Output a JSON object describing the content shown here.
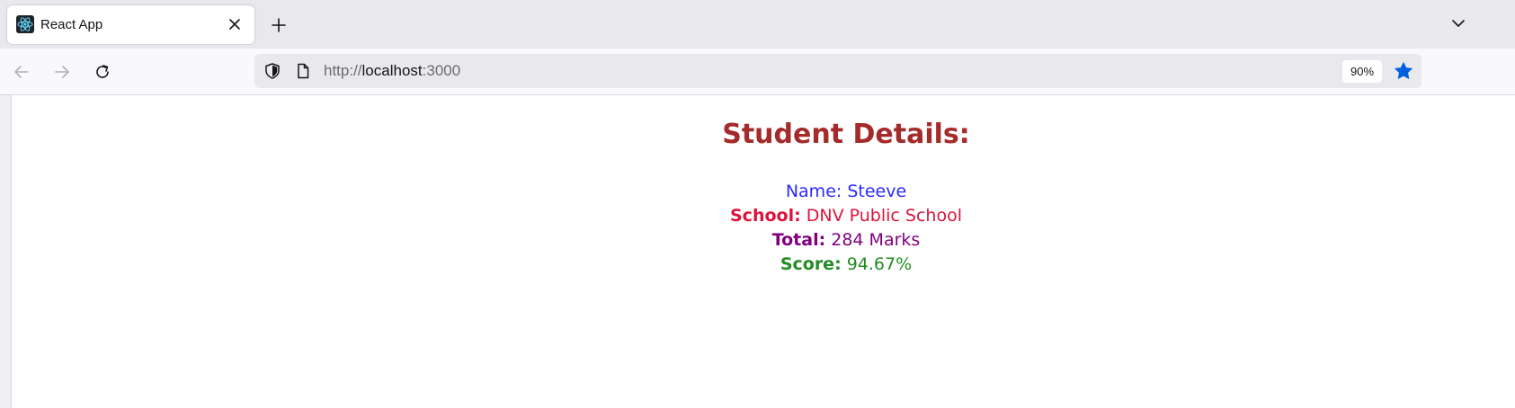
{
  "browser": {
    "tab": {
      "title": "React App",
      "favicon": "react-icon"
    },
    "address_bar": {
      "scheme": "http://",
      "host": "localhost",
      "port": ":3000",
      "zoom": "90%"
    },
    "icons": {
      "close": "close-icon",
      "new_tab": "plus-icon",
      "tab_list": "chevron-down-icon",
      "back": "back-arrow-icon",
      "forward": "forward-arrow-icon",
      "reload": "reload-icon",
      "tracking_protection": "shield-icon",
      "page_info": "page-icon",
      "bookmark": "star-icon"
    },
    "colors": {
      "bookmark_star": "#0061e0"
    }
  },
  "page": {
    "heading": "Student Details:",
    "name": {
      "label": "Name:",
      "value": "Steeve",
      "color": "#2a2aff"
    },
    "school": {
      "label": "School:",
      "value": "DNV Public School",
      "color": "#dc143c"
    },
    "total": {
      "label": "Total:",
      "value": "284 Marks",
      "color": "#800080"
    },
    "score": {
      "label": "Score:",
      "value": "94.67%",
      "color": "#228b22"
    },
    "heading_color": "#a52a2a"
  }
}
